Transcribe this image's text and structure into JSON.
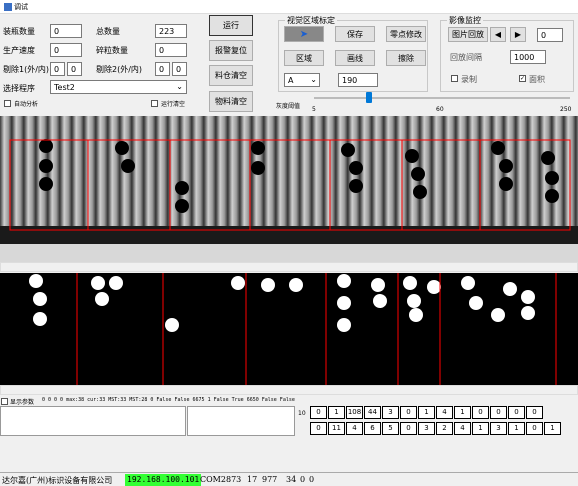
{
  "window": {
    "title": "调试"
  },
  "counters": {
    "filled_label": "装瓶数量",
    "filled_value": "0",
    "total_label": "总数量",
    "total_value": "223",
    "speed_label": "生产速度",
    "speed_value": "0",
    "broken_label": "碎粒数量",
    "broken_value": "0",
    "reject1_label": "剔除1(外/内)",
    "reject1_a": "0",
    "reject1_b": "0",
    "reject2_label": "剔除2(外/内)",
    "reject2_a": "0",
    "reject2_b": "0",
    "program_label": "选择程序",
    "program_value": "Test2",
    "auto_analyze_label": "自动分析",
    "run_clear_label": "运行清空"
  },
  "actions": {
    "run": "运行",
    "alarm_reset": "报警复位",
    "stock_clear": "料仓清空",
    "material_clear": "物料清空"
  },
  "vision": {
    "title": "视觉区域标定",
    "save": "保存",
    "zero_modify": "零点修改",
    "area": "区域",
    "draw": "画线",
    "erase": "擦除",
    "letter": "A",
    "value": "190",
    "gray_label": "灰度阈值",
    "slider_min": "5",
    "slider_mid": "60",
    "slider_max": "250",
    "slider_value": 70
  },
  "image_monitor": {
    "title": "影像监控",
    "replay": "图片回放",
    "frame": "0",
    "interval_label": "回放间隔",
    "interval_value": "1000",
    "record_label": "录制",
    "area_label": "面积"
  },
  "params": {
    "show_label": "显示参数",
    "line": "0  0  0  0  max:38 cur:33  MST:33  MST:28 0  False False 6675 1 False True 6650 False False"
  },
  "grid": {
    "rows": [
      [
        "0",
        "1",
        "108",
        "44",
        "3",
        "0",
        "1",
        "4",
        "1",
        "0",
        "0",
        "0",
        "0"
      ],
      [
        "0",
        "11",
        "4",
        "6",
        "5",
        "0",
        "3",
        "2",
        "4",
        "1",
        "3",
        "1",
        "0",
        "1"
      ]
    ],
    "left_number": "10"
  },
  "status": {
    "company": "达尔嘉(广州)标识设备有限公司",
    "ip": "192.168.100.101",
    "port": "COM2",
    "v1": "873",
    "v2": "17",
    "v3": "977",
    "v4": "34",
    "v5": "0",
    "v6": "0"
  },
  "colors": {
    "ip_bg": "#33ff33",
    "roi": "#ff0000"
  }
}
